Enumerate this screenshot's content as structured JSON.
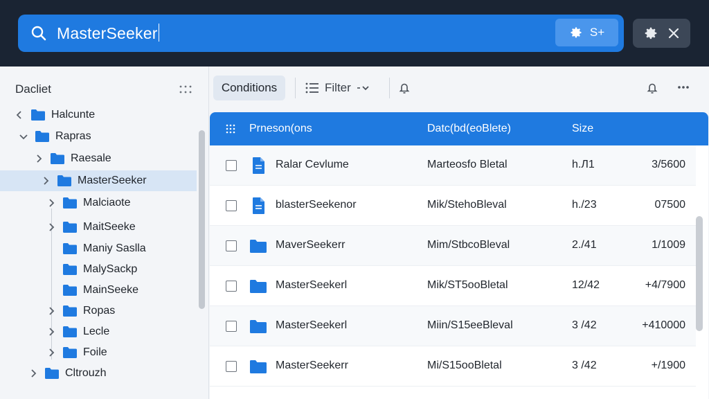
{
  "search": {
    "query": "MasterSeeker",
    "options_label": "S+"
  },
  "sidebar": {
    "title": "Dacliet",
    "items": [
      {
        "label": "Halcunte",
        "chevron": "left"
      },
      {
        "label": "Rapras",
        "chevron": "down"
      },
      {
        "label": "Raesale",
        "chevron": "right"
      },
      {
        "label": "MasterSeeker",
        "chevron": "right",
        "selected": true
      },
      {
        "label": "Malciaote",
        "chevron": "right"
      },
      {
        "label": "MaitSeeke",
        "chevron": "right"
      },
      {
        "label": "Maniy Saslla",
        "chevron": "none"
      },
      {
        "label": "MalySackp",
        "chevron": "none"
      },
      {
        "label": "MainSeeke",
        "chevron": "none"
      },
      {
        "label": "Ropas",
        "chevron": "right"
      },
      {
        "label": "Lecle",
        "chevron": "right"
      },
      {
        "label": "Foile",
        "chevron": "right"
      },
      {
        "label": "Cltrouzh",
        "chevron": "right"
      }
    ]
  },
  "toolbar": {
    "conditions_label": "Conditions",
    "filter_label": "Filter"
  },
  "table": {
    "columns": [
      "Prneson(ons",
      "Datc(bd(eoBlete)",
      "Size"
    ],
    "rows": [
      {
        "icon": "document",
        "name": "Ralar Cevlume",
        "date": "Marteosfo Bletal",
        "c3": "h.Л1",
        "size": "3/5600"
      },
      {
        "icon": "document",
        "name": "blasterSeekenor",
        "date": "Mik/StehoBleval",
        "c3": "h./23",
        "size": "07500"
      },
      {
        "icon": "folder",
        "name": "MaverSeekerr",
        "date": "Mim/StbcoBleval",
        "c3": "2./41",
        "size": "1/1009"
      },
      {
        "icon": "folder",
        "name": "MasterSeekerl",
        "date": "Mik/ST5ooBletal",
        "c3": "12/42",
        "size": "+4/7900"
      },
      {
        "icon": "folder",
        "name": "MasterSeekerl",
        "date": "Miin/S15eeBleval",
        "c3": "3 /42",
        "size": "+410000"
      },
      {
        "icon": "folder",
        "name": "MasterSeekerr",
        "date": "Mi/S15ooBletal",
        "c3": "3 /42",
        "size": "+/1900"
      }
    ]
  },
  "colors": {
    "accent": "#1f7ae0",
    "titlebar": "#1a2433",
    "folder": "#1f7ae0"
  }
}
